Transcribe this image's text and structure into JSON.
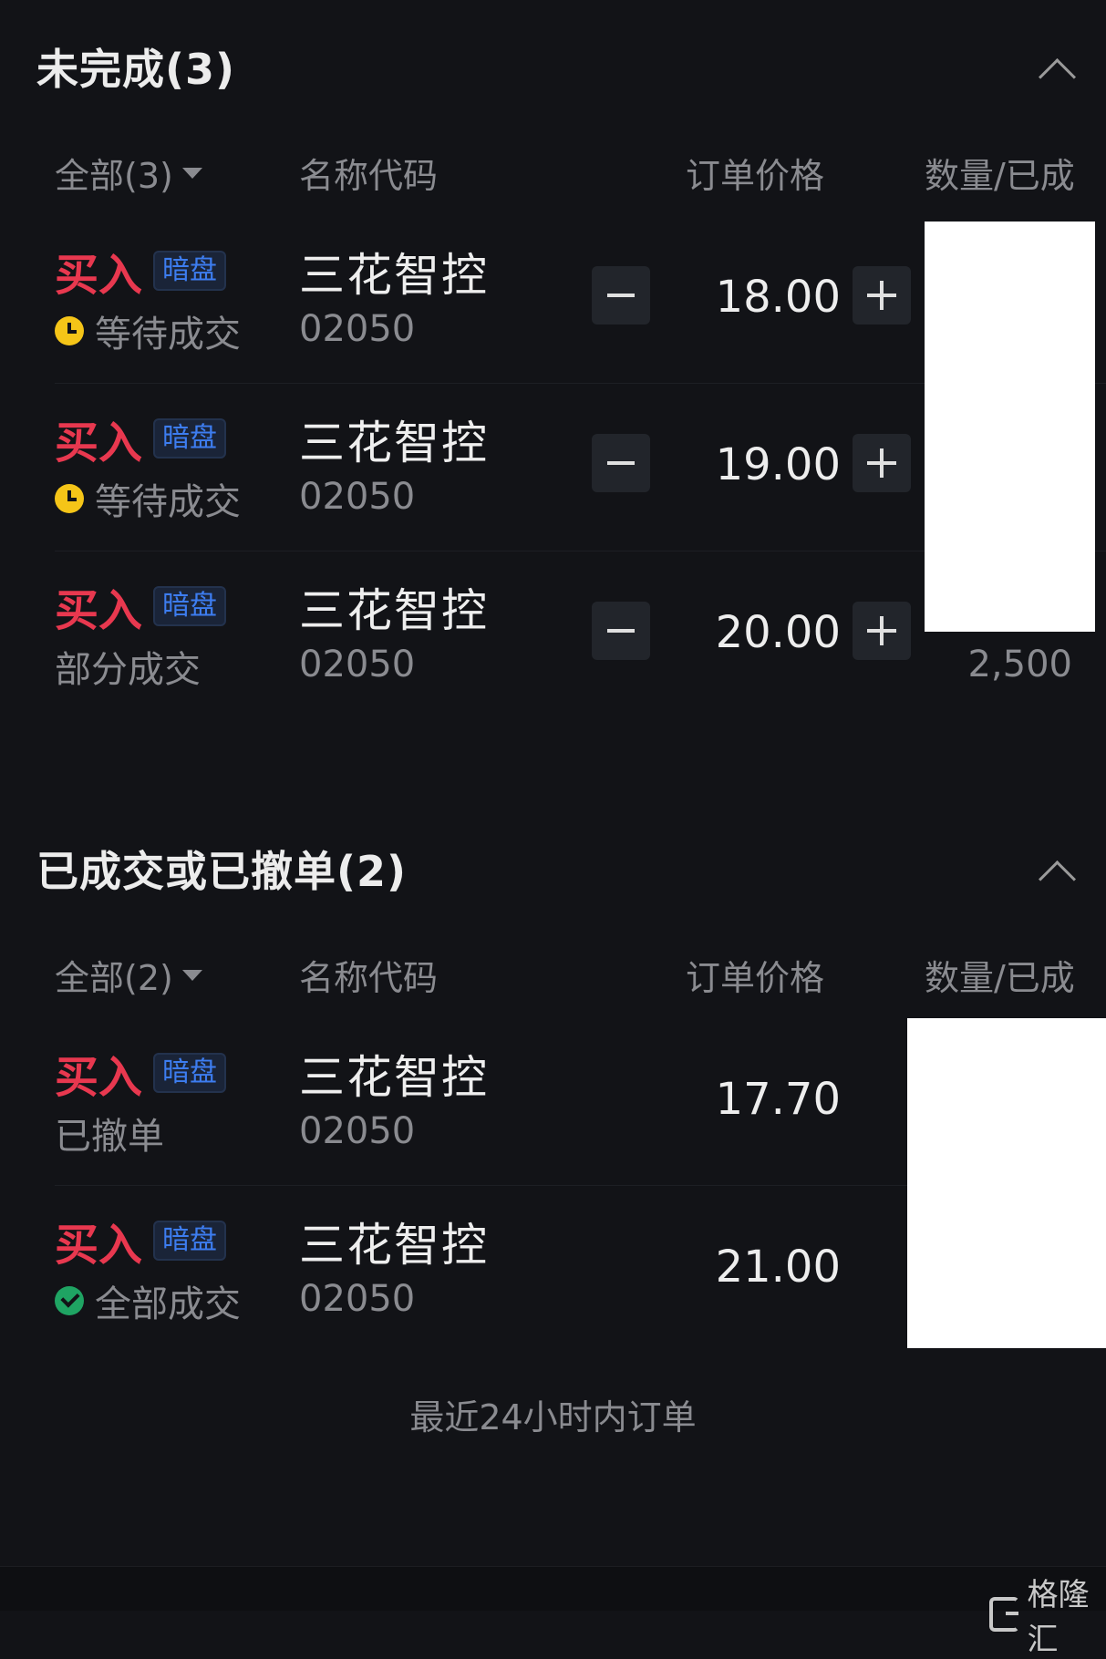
{
  "pending": {
    "title": "未完成(3)",
    "filter": "全部(3)",
    "headers": {
      "name": "名称代码",
      "price": "订单价格",
      "qty": "数量/已成"
    },
    "orders": [
      {
        "side": "买入",
        "tag": "暗盘",
        "status": "等待成交",
        "status_icon": "clock-icon",
        "name": "三花智控",
        "code": "02050",
        "price": "18.00",
        "qty": ""
      },
      {
        "side": "买入",
        "tag": "暗盘",
        "status": "等待成交",
        "status_icon": "clock-icon",
        "name": "三花智控",
        "code": "02050",
        "price": "19.00",
        "qty": ""
      },
      {
        "side": "买入",
        "tag": "暗盘",
        "status": "部分成交",
        "status_icon": "",
        "name": "三花智控",
        "code": "02050",
        "price": "20.00",
        "qty": "2,500"
      }
    ]
  },
  "done": {
    "title": "已成交或已撤单(2)",
    "filter": "全部(2)",
    "headers": {
      "name": "名称代码",
      "price": "订单价格",
      "qty": "数量/已成"
    },
    "orders": [
      {
        "side": "买入",
        "tag": "暗盘",
        "status": "已撤单",
        "status_icon": "",
        "name": "三花智控",
        "code": "02050",
        "price": "17.70"
      },
      {
        "side": "买入",
        "tag": "暗盘",
        "status": "全部成交",
        "status_icon": "check-icon",
        "name": "三花智控",
        "code": "02050",
        "price": "21.00"
      }
    ]
  },
  "footer_note": "最近24小时内订单",
  "watermark": "格隆汇",
  "colors": {
    "background": "#121317",
    "buy": "#e8384f",
    "tag": "#3d7df0",
    "pending_icon": "#f5c518",
    "done_icon": "#1fa463"
  }
}
